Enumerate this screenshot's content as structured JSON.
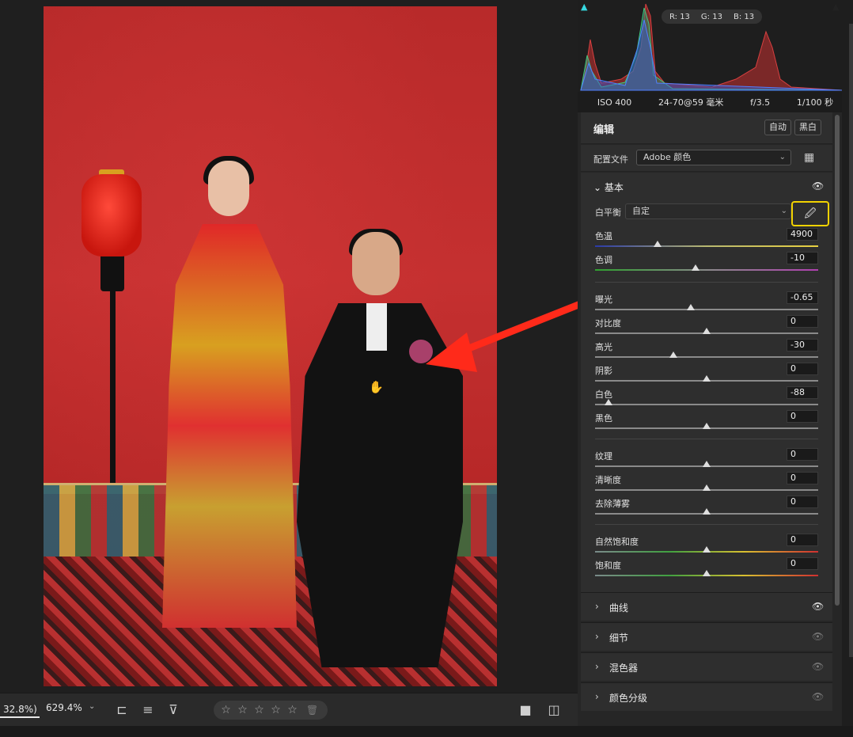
{
  "histogram": {
    "readout": {
      "r": "R: 13",
      "g": "G: 13",
      "b": "B: 13"
    }
  },
  "exif": {
    "iso": "ISO 400",
    "lens": "24-70@59 毫米",
    "aperture": "f/3.5",
    "shutter": "1/100 秒"
  },
  "edit": {
    "title": "编辑",
    "auto": "自动",
    "bw": "黑白"
  },
  "profile": {
    "label": "配置文件",
    "value": "Adobe 颜色"
  },
  "basic": {
    "title": "基本",
    "wb_label": "白平衡",
    "wb_value": "自定",
    "sliders": [
      {
        "label": "色温",
        "value": "4900",
        "pos": 0.28
      },
      {
        "label": "色调",
        "value": "-10",
        "pos": 0.45
      },
      {
        "label": "曝光",
        "value": "-0.65",
        "pos": 0.43
      },
      {
        "label": "对比度",
        "value": "0",
        "pos": 0.5
      },
      {
        "label": "高光",
        "value": "-30",
        "pos": 0.35
      },
      {
        "label": "阴影",
        "value": "0",
        "pos": 0.5
      },
      {
        "label": "白色",
        "value": "-88",
        "pos": 0.06
      },
      {
        "label": "黑色",
        "value": "0",
        "pos": 0.5
      },
      {
        "label": "纹理",
        "value": "0",
        "pos": 0.5
      },
      {
        "label": "清晰度",
        "value": "0",
        "pos": 0.5
      },
      {
        "label": "去除薄雾",
        "value": "0",
        "pos": 0.5
      },
      {
        "label": "自然饱和度",
        "value": "0",
        "pos": 0.5
      },
      {
        "label": "饱和度",
        "value": "0",
        "pos": 0.5
      }
    ]
  },
  "collapsed_sections": [
    "曲线",
    "细节",
    "混色器",
    "颜色分级"
  ],
  "bottombar": {
    "zoom_fit": "32.8%)",
    "zoom_pct": "629.4%"
  },
  "colors": {
    "accent_yellow": "#f2d200",
    "arrow_red": "#ff2a1a",
    "wall_red": "#c53030"
  }
}
